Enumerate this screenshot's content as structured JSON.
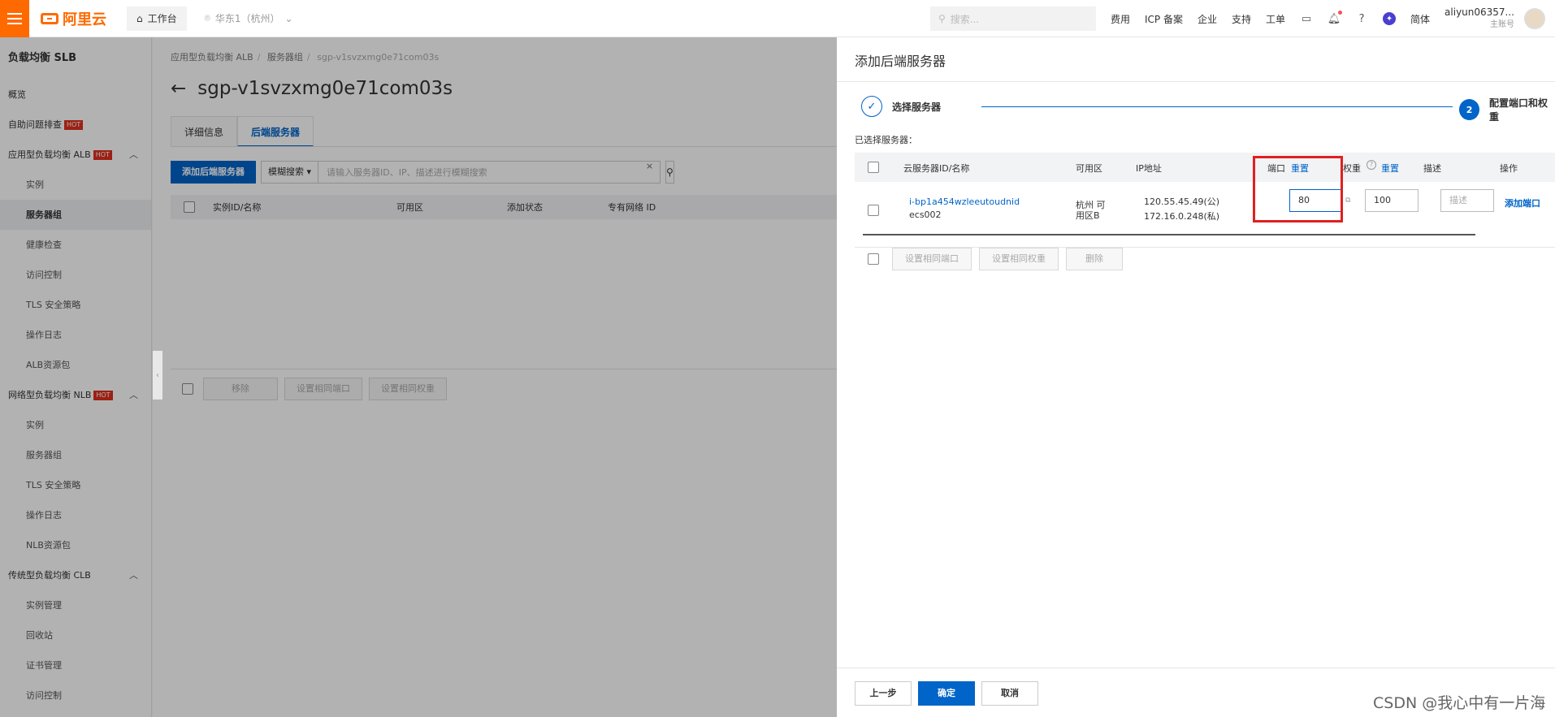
{
  "topbar": {
    "logo": "阿里云",
    "workbench": "工作台",
    "region": "华东1（杭州）",
    "search_placeholder": "搜索...",
    "links": [
      "费用",
      "ICP 备案",
      "企业",
      "支持",
      "工单"
    ],
    "lang": "简体",
    "user_name": "aliyun06357...",
    "user_role": "主账号"
  },
  "sidebar": {
    "title": "负载均衡 SLB",
    "items": [
      {
        "label": "概览"
      },
      {
        "label": "自助问题排查",
        "badge": "HOT"
      },
      {
        "label": "应用型负载均衡 ALB",
        "badge": "HOT"
      },
      {
        "label": "实例"
      },
      {
        "label": "服务器组"
      },
      {
        "label": "健康检查"
      },
      {
        "label": "访问控制"
      },
      {
        "label": "TLS 安全策略"
      },
      {
        "label": "操作日志"
      },
      {
        "label": "ALB资源包"
      },
      {
        "label": "网络型负载均衡 NLB",
        "badge": "HOT"
      },
      {
        "label": "实例"
      },
      {
        "label": "服务器组"
      },
      {
        "label": "TLS 安全策略"
      },
      {
        "label": "操作日志"
      },
      {
        "label": "NLB资源包"
      },
      {
        "label": "传统型负载均衡 CLB"
      },
      {
        "label": "实例管理"
      },
      {
        "label": "回收站"
      },
      {
        "label": "证书管理"
      },
      {
        "label": "访问控制"
      }
    ]
  },
  "main": {
    "breadcrumb": [
      "应用型负载均衡 ALB",
      "服务器组",
      "sgp-v1svzxmg0e71com03s"
    ],
    "title": "sgp-v1svzxmg0e71com03s",
    "tabs": [
      "详细信息",
      "后端服务器"
    ],
    "add_button": "添加后端服务器",
    "search_mode": "模糊搜索",
    "search_placeholder": "请输入服务器ID、IP、描述进行模糊搜索",
    "columns": [
      "实例ID/名称",
      "可用区",
      "添加状态",
      "专有网络 ID"
    ],
    "bottom_buttons": [
      "移除",
      "设置相同端口",
      "设置相同权重"
    ]
  },
  "drawer": {
    "title": "添加后端服务器",
    "step1": "选择服务器",
    "step2_num": "2",
    "step2": "配置端口和权重",
    "selected_label": "已选择服务器：",
    "columns": {
      "id": "云服务器ID/名称",
      "zone": "可用区",
      "ip": "IP地址",
      "port": "端口",
      "port_reset": "重置",
      "weight": "权重",
      "weight_reset": "重置",
      "desc": "描述",
      "action": "操作"
    },
    "row": {
      "id": "i-bp1a454wzleeutoudnid",
      "name": "ecs002",
      "zone": "杭州 可用区B",
      "ip_public": "120.55.45.49(公)",
      "ip_private": "172.16.0.248(私)",
      "port": "80",
      "weight": "100",
      "desc_placeholder": "描述",
      "action": "添加端口"
    },
    "batch_buttons": [
      "设置相同端口",
      "设置相同权重",
      "删除"
    ],
    "footer": {
      "prev": "上一步",
      "ok": "确定",
      "cancel": "取消"
    }
  },
  "watermark": "CSDN @我心中有一片海",
  "colors": {
    "accent": "#0064c8",
    "brand": "#ff6a00",
    "highlight": "#e02020"
  }
}
